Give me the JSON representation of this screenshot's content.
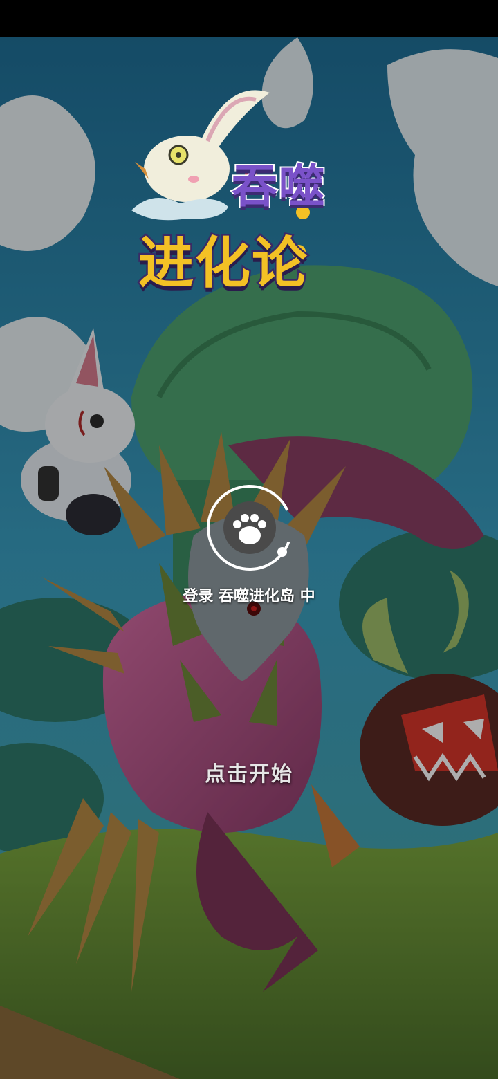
{
  "logo": {
    "line1": "吞噬",
    "line2": "进化论"
  },
  "loading": {
    "text": "登录 吞噬进化岛 中",
    "icon": "paw-icon"
  },
  "start": {
    "label": "点击开始"
  },
  "colors": {
    "sky": "#2f8bb5",
    "foliage": "#3f9a6a",
    "logo_purple": "#7a52c9",
    "logo_yellow": "#f3c125",
    "ground": "#6f9a37"
  }
}
